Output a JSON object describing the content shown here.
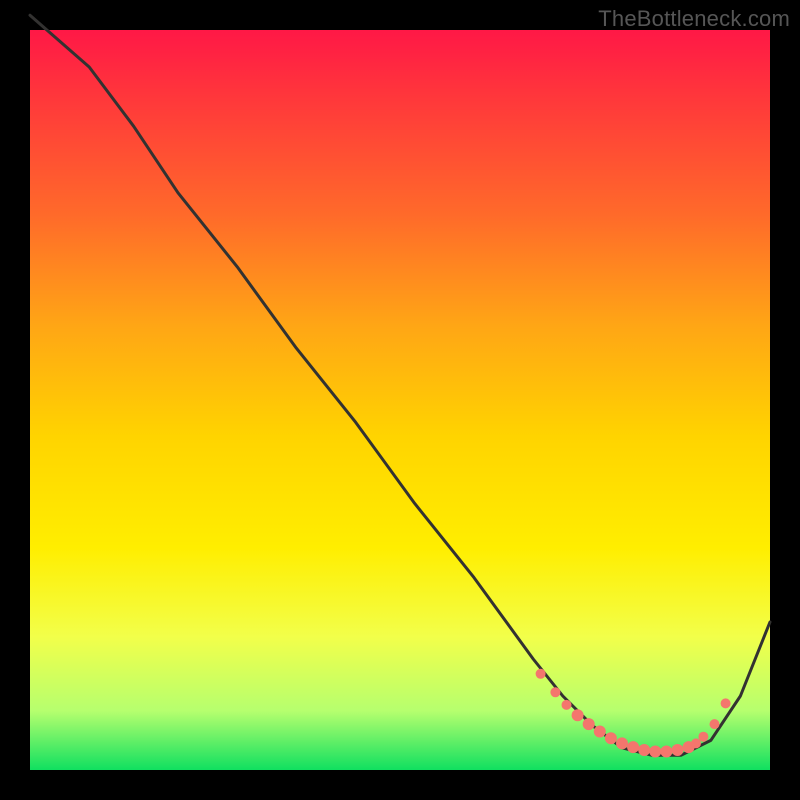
{
  "watermark": "TheBottleneck.com",
  "chart_data": {
    "type": "line",
    "title": "",
    "xlabel": "",
    "ylabel": "",
    "xlim": [
      0,
      100
    ],
    "ylim": [
      0,
      100
    ],
    "grid": false,
    "legend": false,
    "series": [
      {
        "name": "curve",
        "x": [
          0,
          8,
          14,
          20,
          28,
          36,
          44,
          52,
          60,
          68,
          72,
          76,
          80,
          84,
          88,
          92,
          96,
          100
        ],
        "y": [
          102,
          95,
          87,
          78,
          68,
          57,
          47,
          36,
          26,
          15,
          10,
          6,
          3,
          2,
          2,
          4,
          10,
          20
        ]
      }
    ],
    "markers": {
      "note": "dotted markers cluster near trough (≈70%–94% of x-range, very low y)",
      "x_pct": [
        69,
        71,
        72.5,
        74,
        75.5,
        77,
        78.5,
        80,
        81.5,
        83,
        84.5,
        86,
        87.5,
        89,
        90,
        91,
        92.5,
        94
      ],
      "y_pct": [
        13,
        10.5,
        8.8,
        7.4,
        6.2,
        5.2,
        4.3,
        3.6,
        3.1,
        2.7,
        2.5,
        2.5,
        2.7,
        3.1,
        3.6,
        4.5,
        6.2,
        9.0
      ],
      "r": [
        5,
        5,
        5,
        6,
        6,
        6,
        6,
        6,
        6,
        6,
        6,
        6,
        6,
        6,
        5,
        5,
        5,
        5
      ]
    },
    "colors": {
      "gradient_top": "#ff1846",
      "gradient_mid": "#ffd400",
      "gradient_bottom": "#10e060",
      "curve": "#333231",
      "markers": "#f4766d",
      "background": "#000000"
    }
  }
}
